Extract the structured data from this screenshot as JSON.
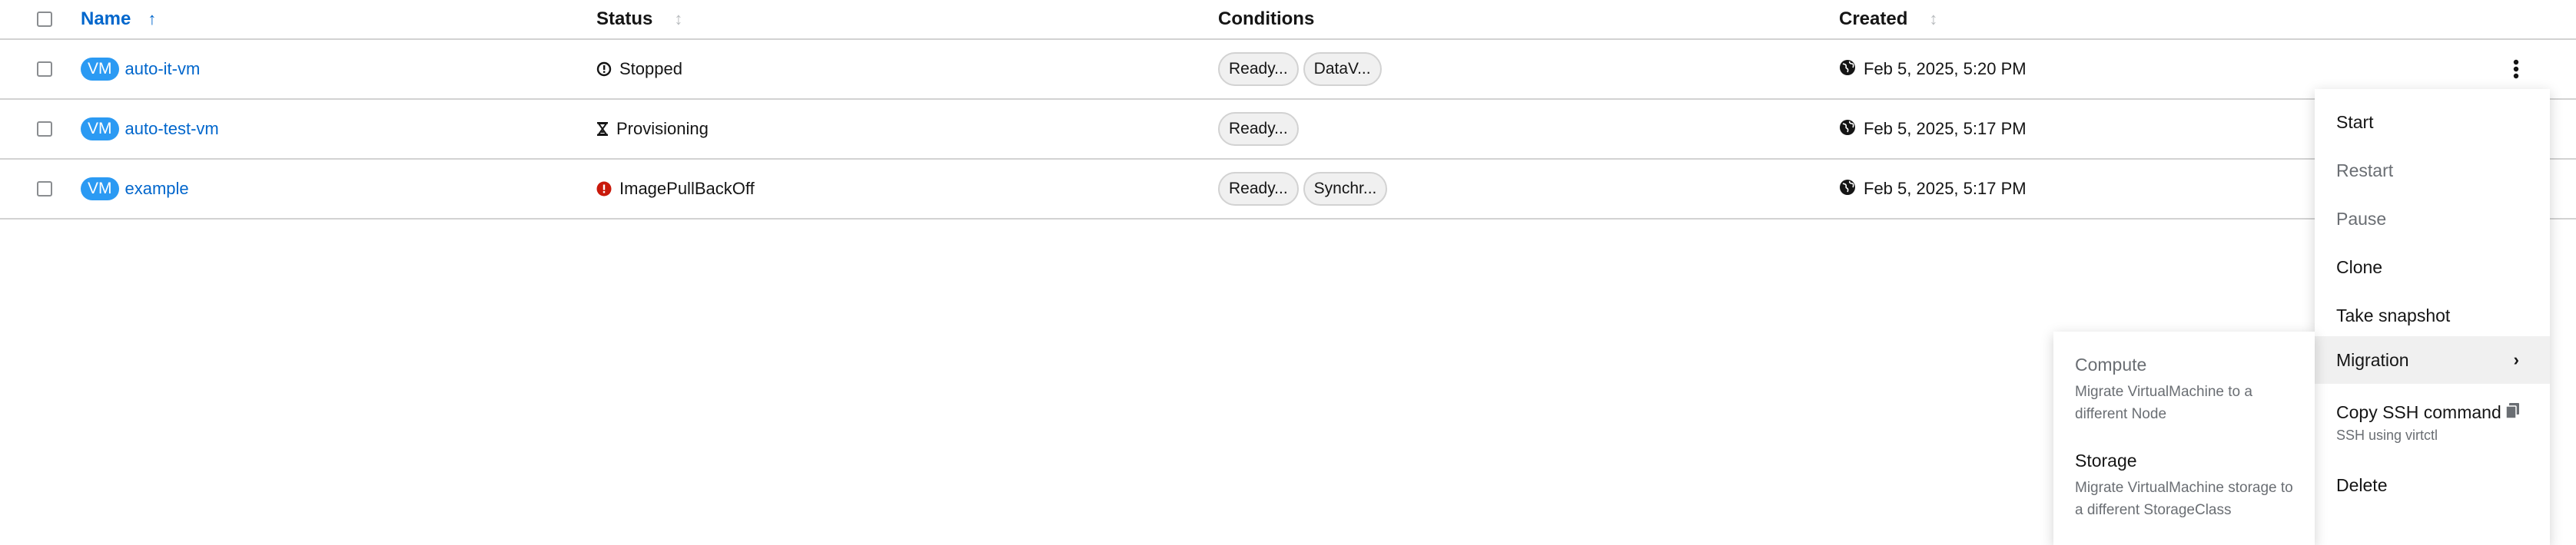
{
  "table": {
    "headers": {
      "name": "Name",
      "status": "Status",
      "conditions": "Conditions",
      "created": "Created"
    },
    "rows": [
      {
        "badge": "VM",
        "name": "auto-it-vm",
        "status": "Stopped",
        "status_icon": "stopped-icon",
        "conditions": [
          "Ready...",
          "DataV..."
        ],
        "created": "Feb 5, 2025, 5:20 PM"
      },
      {
        "badge": "VM",
        "name": "auto-test-vm",
        "status": "Provisioning",
        "status_icon": "hourglass-icon",
        "conditions": [
          "Ready..."
        ],
        "created": "Feb 5, 2025, 5:17 PM"
      },
      {
        "badge": "VM",
        "name": "example",
        "status": "ImagePullBackOff",
        "status_icon": "error-icon",
        "conditions": [
          "Ready...",
          "Synchr..."
        ],
        "created": "Feb 5, 2025, 5:17 PM"
      }
    ]
  },
  "actions_menu": {
    "items": [
      {
        "label": "Start",
        "disabled": false
      },
      {
        "label": "Restart",
        "disabled": true
      },
      {
        "label": "Pause",
        "disabled": true
      },
      {
        "label": "Clone",
        "disabled": false
      },
      {
        "label": "Take snapshot",
        "disabled": false
      },
      {
        "label": "Migration",
        "disabled": false,
        "has_submenu": true
      },
      {
        "label": "Copy SSH command",
        "description": "SSH using virtctl",
        "disabled": false
      },
      {
        "label": "Delete",
        "disabled": false
      }
    ]
  },
  "migration_submenu": {
    "items": [
      {
        "label": "Compute",
        "description": "Migrate VirtualMachine to a different Node",
        "disabled": true
      },
      {
        "label": "Storage",
        "description": "Migrate VirtualMachine storage to a different StorageClass",
        "disabled": false
      }
    ]
  },
  "colors": {
    "link": "#0066cc",
    "badge": "#2b9af3",
    "error": "#c9190b",
    "border": "#d2d2d2"
  }
}
